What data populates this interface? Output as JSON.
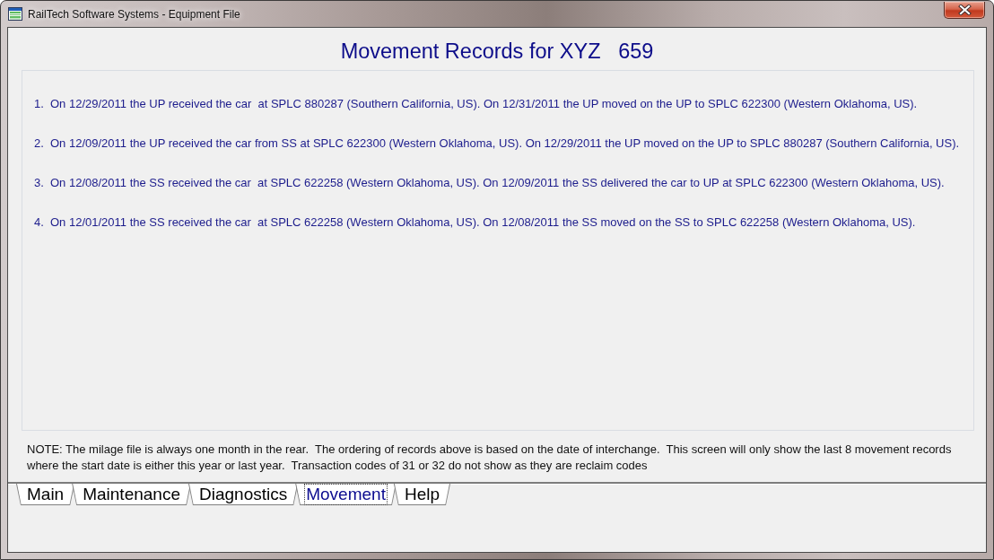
{
  "window": {
    "title": "RailTech Software Systems - Equipment File"
  },
  "heading": "Movement Records for XYZ   659",
  "records": [
    {
      "number": "1.",
      "text": "On 12/29/2011 the UP received the car  at SPLC 880287 (Southern California, US). On 12/31/2011 the UP moved on the UP to SPLC 622300 (Western Oklahoma, US)."
    },
    {
      "number": "2.",
      "text": "On 12/09/2011 the UP received the car from SS at SPLC 622300 (Western Oklahoma, US). On 12/29/2011 the UP moved on the UP to SPLC 880287 (Southern California, US)."
    },
    {
      "number": "3.",
      "text": "On 12/08/2011 the SS received the car  at SPLC 622258 (Western Oklahoma, US). On 12/09/2011 the SS delivered the car to UP at SPLC 622300 (Western Oklahoma, US)."
    },
    {
      "number": "4.",
      "text": "On 12/01/2011 the SS received the car  at SPLC 622258 (Western Oklahoma, US). On 12/08/2011 the SS moved on the SS to SPLC 622258 (Western Oklahoma, US)."
    }
  ],
  "note": "NOTE: The milage file is always one month in the rear.  The ordering of records above is based on the date of interchange.  This screen will only show the last 8 movement records where the start date is either this year or last year.  Transaction codes of 31 or 32 do not show as they are reclaim codes",
  "tabs": [
    {
      "label": "Main",
      "selected": false
    },
    {
      "label": "Maintenance",
      "selected": false
    },
    {
      "label": "Diagnostics",
      "selected": false
    },
    {
      "label": "Movement",
      "selected": true
    },
    {
      "label": "Help",
      "selected": false
    }
  ]
}
